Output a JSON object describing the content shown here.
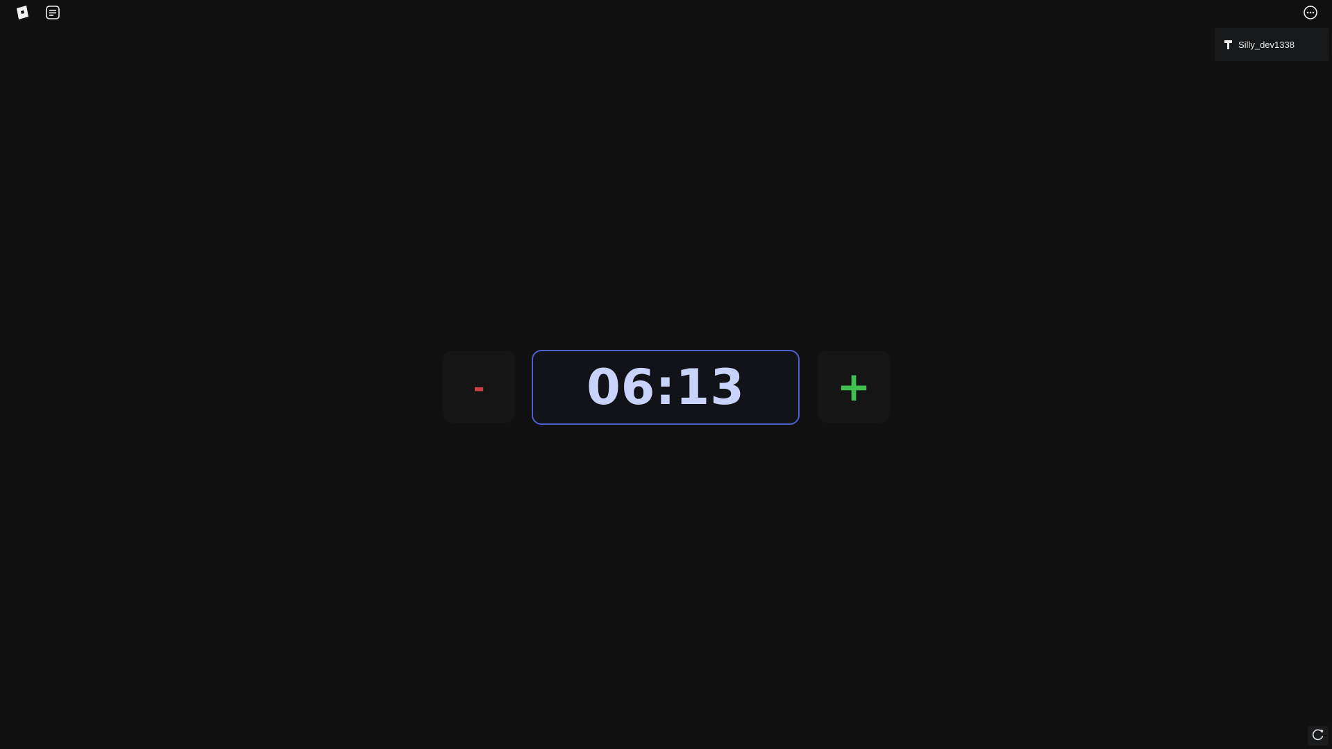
{
  "topbar": {
    "roblox_icon": "roblox-logo-icon",
    "chat_icon": "chat-icon",
    "menu_icon": "more-icon"
  },
  "player_list": {
    "players": [
      {
        "name": "Silly_dev1338",
        "icon": "developer-hammer-icon"
      }
    ]
  },
  "timer": {
    "minus_label": "-",
    "plus_label": "+",
    "time": "06:13",
    "colors": {
      "minus": "#c9404a",
      "plus": "#3fbf4e",
      "text": "#c9d2fa",
      "border": "#4f5fcf"
    }
  },
  "corner": {
    "refresh_icon": "refresh-icon"
  }
}
